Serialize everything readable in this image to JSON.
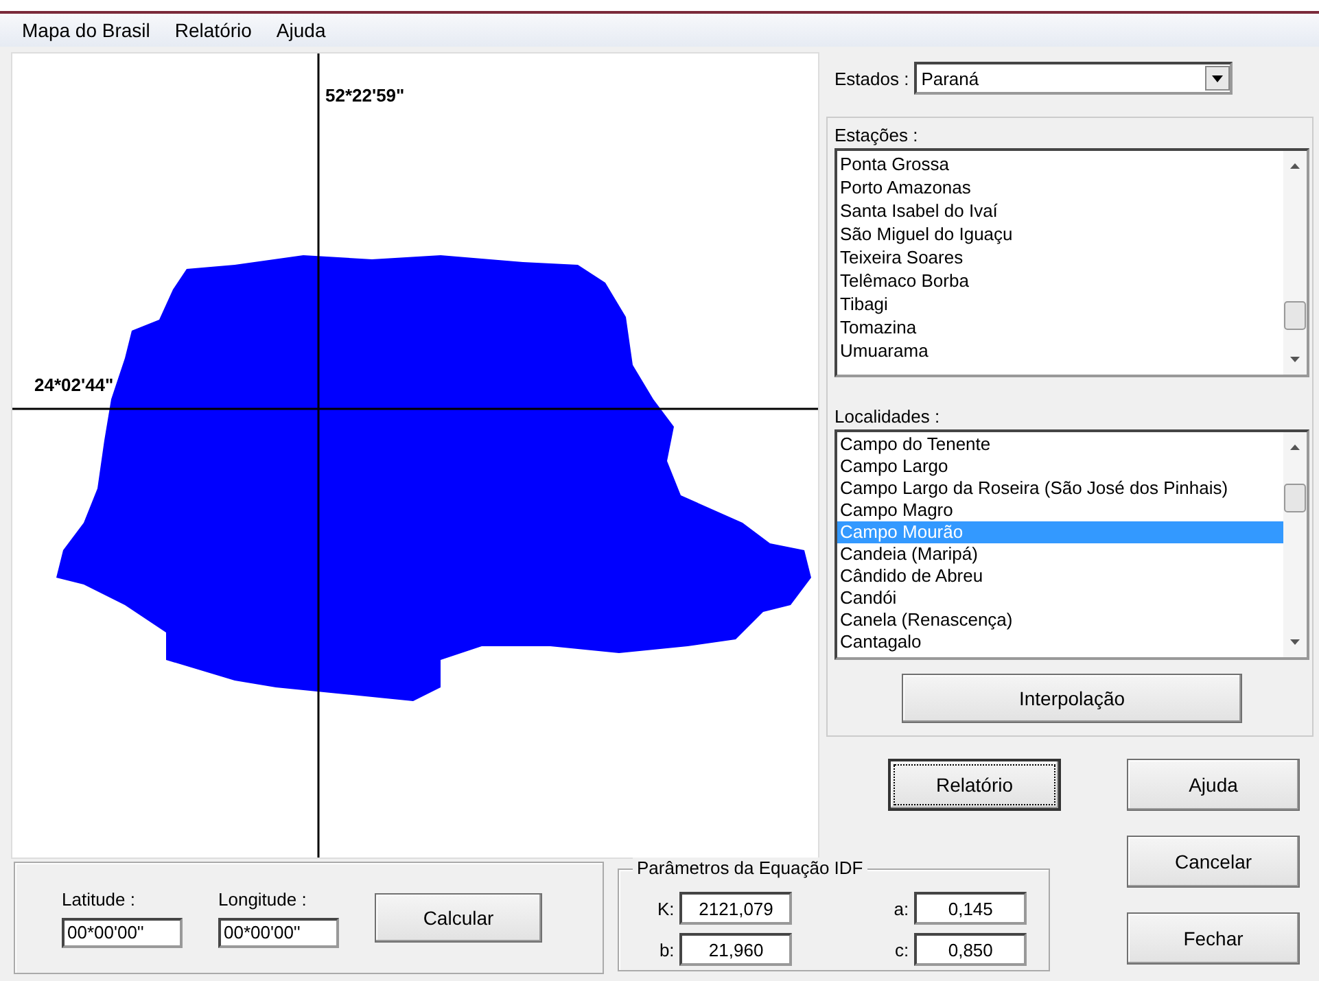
{
  "menu": [
    {
      "label": "Mapa do Brasil"
    },
    {
      "label": "Relatório"
    },
    {
      "label": "Ajuda"
    }
  ],
  "map": {
    "longitude_label": "52*22'59\"",
    "latitude_label": "24*02'44\""
  },
  "estados": {
    "label": "Estados :",
    "value": "Paraná"
  },
  "estacoes": {
    "label": "Estações :",
    "items": [
      {
        "label": "Ponta Grossa",
        "selected": false
      },
      {
        "label": "Porto Amazonas",
        "selected": false
      },
      {
        "label": "Santa Isabel do Ivaí",
        "selected": false
      },
      {
        "label": "São Miguel do Iguaçu",
        "selected": false
      },
      {
        "label": "Teixeira Soares",
        "selected": false
      },
      {
        "label": "Telêmaco Borba",
        "selected": false
      },
      {
        "label": "Tibagi",
        "selected": false
      },
      {
        "label": "Tomazina",
        "selected": false
      },
      {
        "label": "Umuarama",
        "selected": false
      }
    ]
  },
  "localidades": {
    "label": "Localidades :",
    "items": [
      {
        "label": "Campo do Tenente",
        "selected": false
      },
      {
        "label": "Campo Largo",
        "selected": false
      },
      {
        "label": "Campo Largo da Roseira (São José dos Pinhais)",
        "selected": false
      },
      {
        "label": "Campo Magro",
        "selected": false
      },
      {
        "label": "Campo Mourão",
        "selected": true
      },
      {
        "label": "Candeia (Maripá)",
        "selected": false
      },
      {
        "label": "Cândido de Abreu",
        "selected": false
      },
      {
        "label": "Candói",
        "selected": false
      },
      {
        "label": "Canela (Renascença)",
        "selected": false
      },
      {
        "label": "Cantagalo",
        "selected": false
      }
    ]
  },
  "interpolacao_button": "Interpolação",
  "coordinates": {
    "latitude_label": "Latitude :",
    "latitude_value": "00*00'00''",
    "longitude_label": "Longitude :",
    "longitude_value": "00*00'00''",
    "calculate_button": "Calcular"
  },
  "idf": {
    "title": "Parâmetros da Equação IDF",
    "params": [
      {
        "label": "K:",
        "value": "2121,079"
      },
      {
        "label": "a:",
        "value": "0,145"
      },
      {
        "label": "b:",
        "value": "21,960"
      },
      {
        "label": "c:",
        "value": "0,850"
      }
    ]
  },
  "buttons": [
    {
      "label": "Relatório",
      "focused": true
    },
    {
      "label": "Ajuda",
      "focused": false
    },
    {
      "label": "Cancelar",
      "focused": false
    },
    {
      "label": "Fechar",
      "focused": false
    }
  ]
}
